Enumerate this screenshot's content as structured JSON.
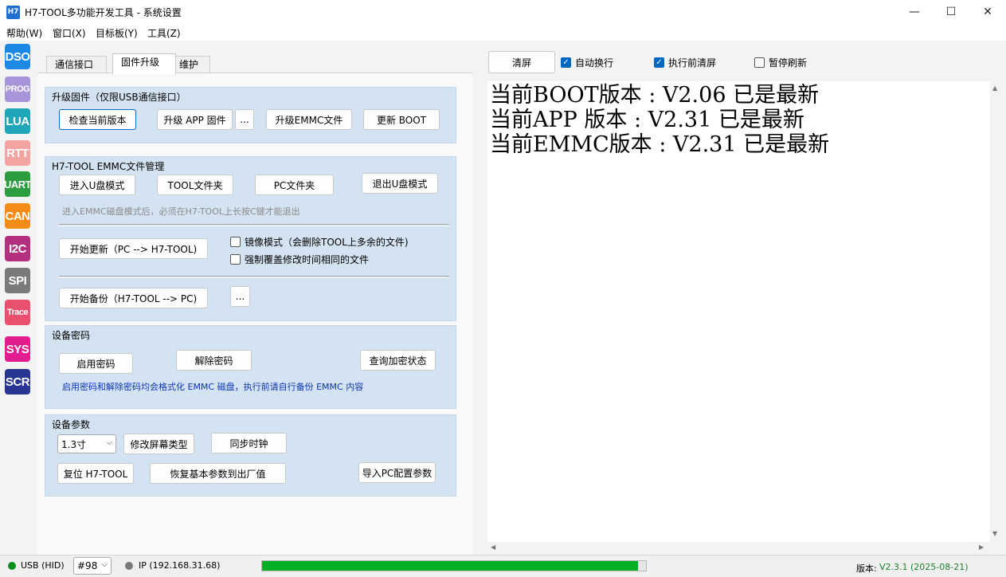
{
  "window": {
    "title": "H7-TOOL多功能开发工具 - 系统设置",
    "icon_label": "H7",
    "controls": [
      "—",
      "☐",
      "✕"
    ]
  },
  "menu": [
    "帮助(W)",
    "窗口(X)",
    "目标板(Y)",
    "工具(Z)"
  ],
  "sidebar": [
    {
      "label": "DSO",
      "color": "#1e88e5"
    },
    {
      "label": "PROG",
      "color": "#a794d9"
    },
    {
      "label": "LUA",
      "color": "#1fa6b8"
    },
    {
      "label": "RTT",
      "color": "#f4a3a3"
    },
    {
      "label": "UART",
      "color": "#2e9d3f"
    },
    {
      "label": "CAN",
      "color": "#f28c16"
    },
    {
      "label": "I2C",
      "color": "#b3307f"
    },
    {
      "label": "SPI",
      "color": "#7a7a7a"
    },
    {
      "label": "Trace",
      "color": "#e8506e"
    },
    {
      "label": "SYS",
      "color": "#e11d8f"
    },
    {
      "label": "SCR",
      "color": "#283593"
    }
  ],
  "tabs": [
    "通信接口",
    "固件升级",
    "维护"
  ],
  "upgrade": {
    "title": "升级固件（仅限USB通信接口）",
    "check_version": "检查当前版本",
    "upgrade_app": "升级 APP 固件",
    "more": "...",
    "upgrade_emmc": "升级EMMC文件",
    "update_boot": "更新 BOOT"
  },
  "emmc": {
    "title": "H7-TOOL EMMC文件管理",
    "enter_udisk": "进入U盘模式",
    "tool_folder": "TOOL文件夹",
    "pc_folder": "PC文件夹",
    "exit_udisk": "退出U盘模式",
    "note": "进入EMMC磁盘模式后，必须在H7-TOOL上长按C键才能退出",
    "start_update": "开始更新（PC --> H7-TOOL)",
    "mirror_mode": "镜像模式（会删除TOOL上多余的文件)",
    "force_overwrite": "强制覆盖修改时间相同的文件",
    "start_backup": "开始备份（H7-TOOL --> PC)",
    "more": "..."
  },
  "password": {
    "title": "设备密码",
    "enable": "启用密码",
    "disable": "解除密码",
    "query": "查询加密状态",
    "note": "启用密码和解除密码均会格式化 EMMC 磁盘，执行前请自行备份 EMMC 内容"
  },
  "params": {
    "title": "设备参数",
    "screen_size": "1.3寸",
    "modify_screen": "修改屏幕类型",
    "sync_clock": "同步时钟",
    "reset": "复位 H7-TOOL",
    "restore_defaults": "恢复基本参数到出厂值",
    "import_pc": "导入PC配置参数"
  },
  "toolbar": {
    "clear": "清屏",
    "auto_wrap": "自动换行",
    "clear_before_exec": "执行前清屏",
    "pause_refresh": "暂停刷新"
  },
  "log": [
    "当前BOOT版本 : V2.06 已是最新",
    "当前APP 版本 : V2.31 已是最新",
    "当前EMMC版本 : V2.31 已是最新"
  ],
  "status": {
    "usb": "USB (HID)",
    "device": "#98",
    "ip": "IP (192.168.31.68)",
    "progress": 0.98,
    "version_label": "版本:",
    "version_value": "V2.3.1 (2025-08-21)"
  }
}
